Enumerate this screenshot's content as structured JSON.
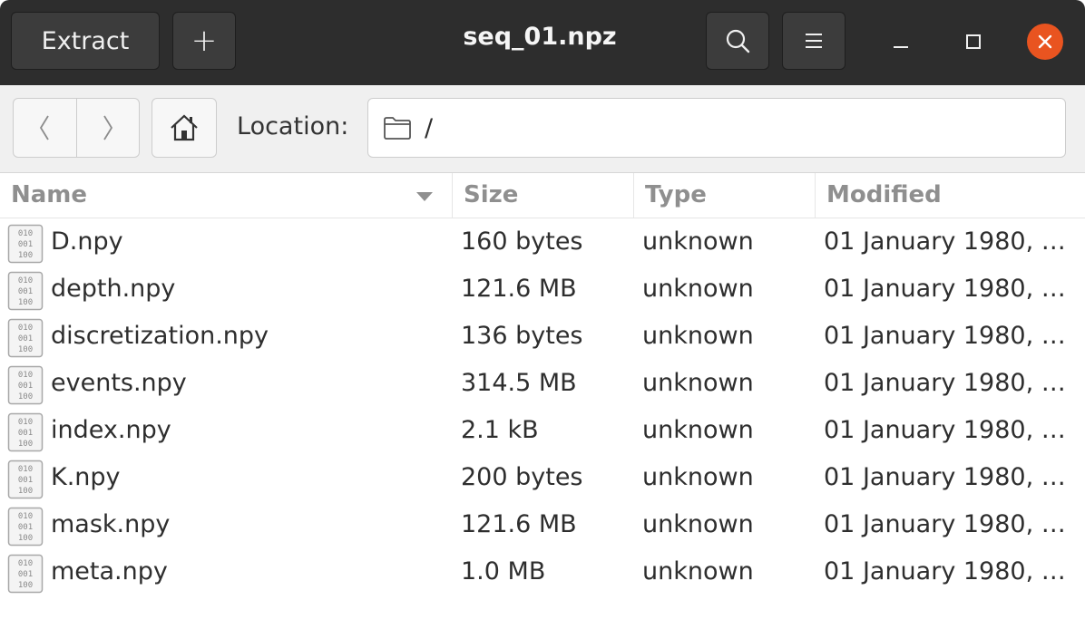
{
  "header": {
    "title": "seq_01.npz",
    "extract_label": "Extract",
    "add_label": "+",
    "icons": [
      "search-icon",
      "menu-icon",
      "minimize-icon",
      "maximize-icon",
      "close-icon"
    ],
    "close_color": "#e95420"
  },
  "toolbar": {
    "location_label": "Location:",
    "location_path": "/",
    "icons": [
      "back-icon",
      "forward-icon",
      "home-icon",
      "folder-icon"
    ]
  },
  "columns": {
    "name": "Name",
    "size": "Size",
    "type": "Type",
    "modified": "Modified",
    "sort": "Name descending-arrow"
  },
  "files": [
    {
      "name": "D.npy",
      "size": "160 bytes",
      "type": "unknown",
      "modified": "01 January 1980, 0…"
    },
    {
      "name": "depth.npy",
      "size": "121.6 MB",
      "type": "unknown",
      "modified": "01 January 1980, 0…"
    },
    {
      "name": "discretization.npy",
      "size": "136 bytes",
      "type": "unknown",
      "modified": "01 January 1980, 0…"
    },
    {
      "name": "events.npy",
      "size": "314.5 MB",
      "type": "unknown",
      "modified": "01 January 1980, 0…"
    },
    {
      "name": "index.npy",
      "size": "2.1 kB",
      "type": "unknown",
      "modified": "01 January 1980, 0…"
    },
    {
      "name": "K.npy",
      "size": "200 bytes",
      "type": "unknown",
      "modified": "01 January 1980, 0…"
    },
    {
      "name": "mask.npy",
      "size": "121.6 MB",
      "type": "unknown",
      "modified": "01 January 1980, 0…"
    },
    {
      "name": "meta.npy",
      "size": "1.0 MB",
      "type": "unknown",
      "modified": "01 January 1980, 0…"
    }
  ]
}
